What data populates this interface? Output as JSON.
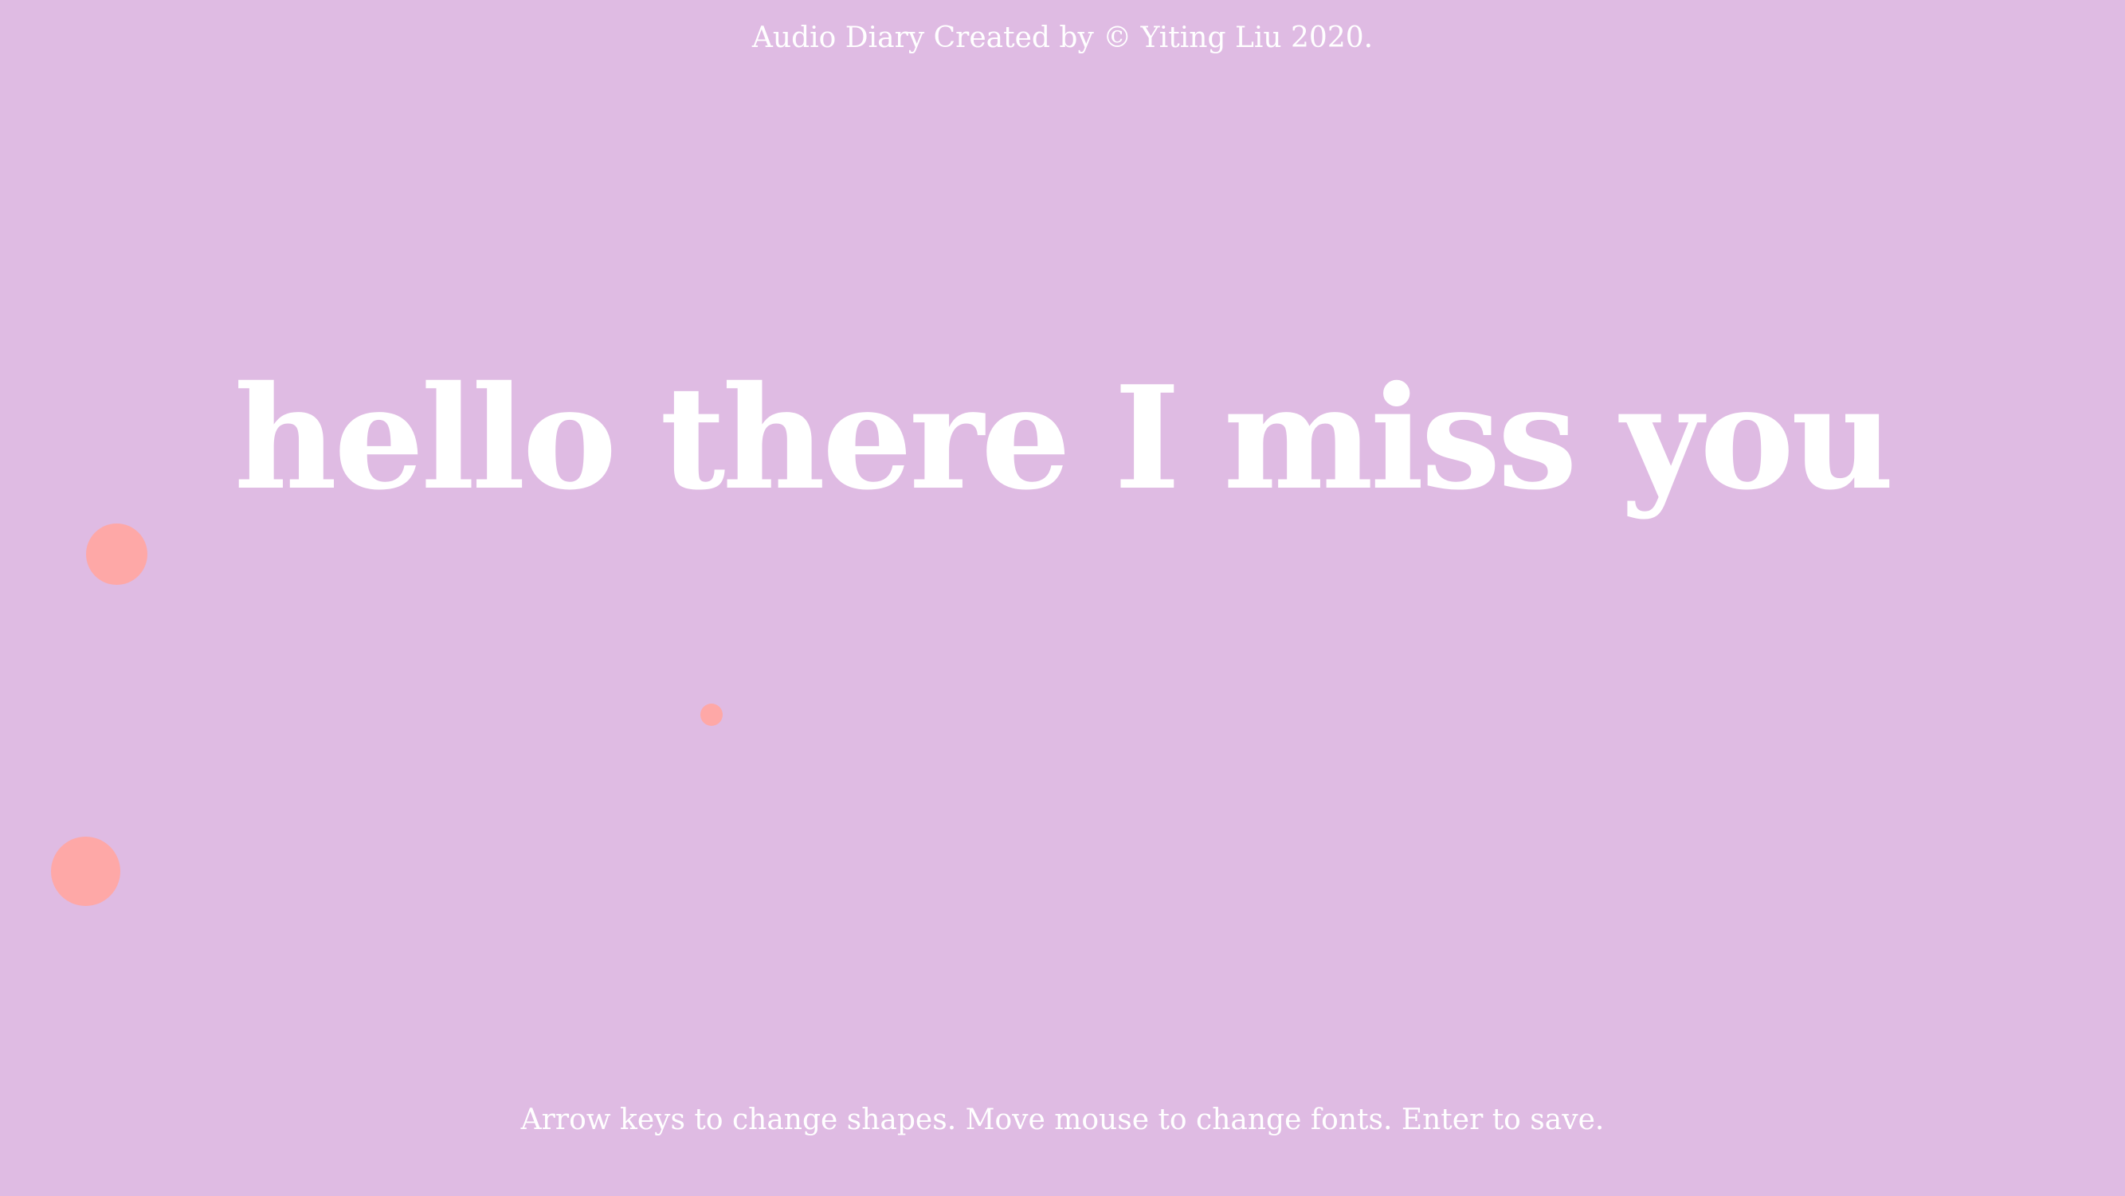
{
  "credit": "Audio Diary Created by © Yiting Liu 2020.",
  "diary_text": "hello there I miss you",
  "instructions": "Arrow keys to change shapes. Move mouse to change fonts. Enter to save.",
  "colors": {
    "background": "#dfbbe3",
    "text": "#ffffff",
    "shape": "#fea8a7"
  },
  "shapes": {
    "type": "circle",
    "count": 3
  }
}
